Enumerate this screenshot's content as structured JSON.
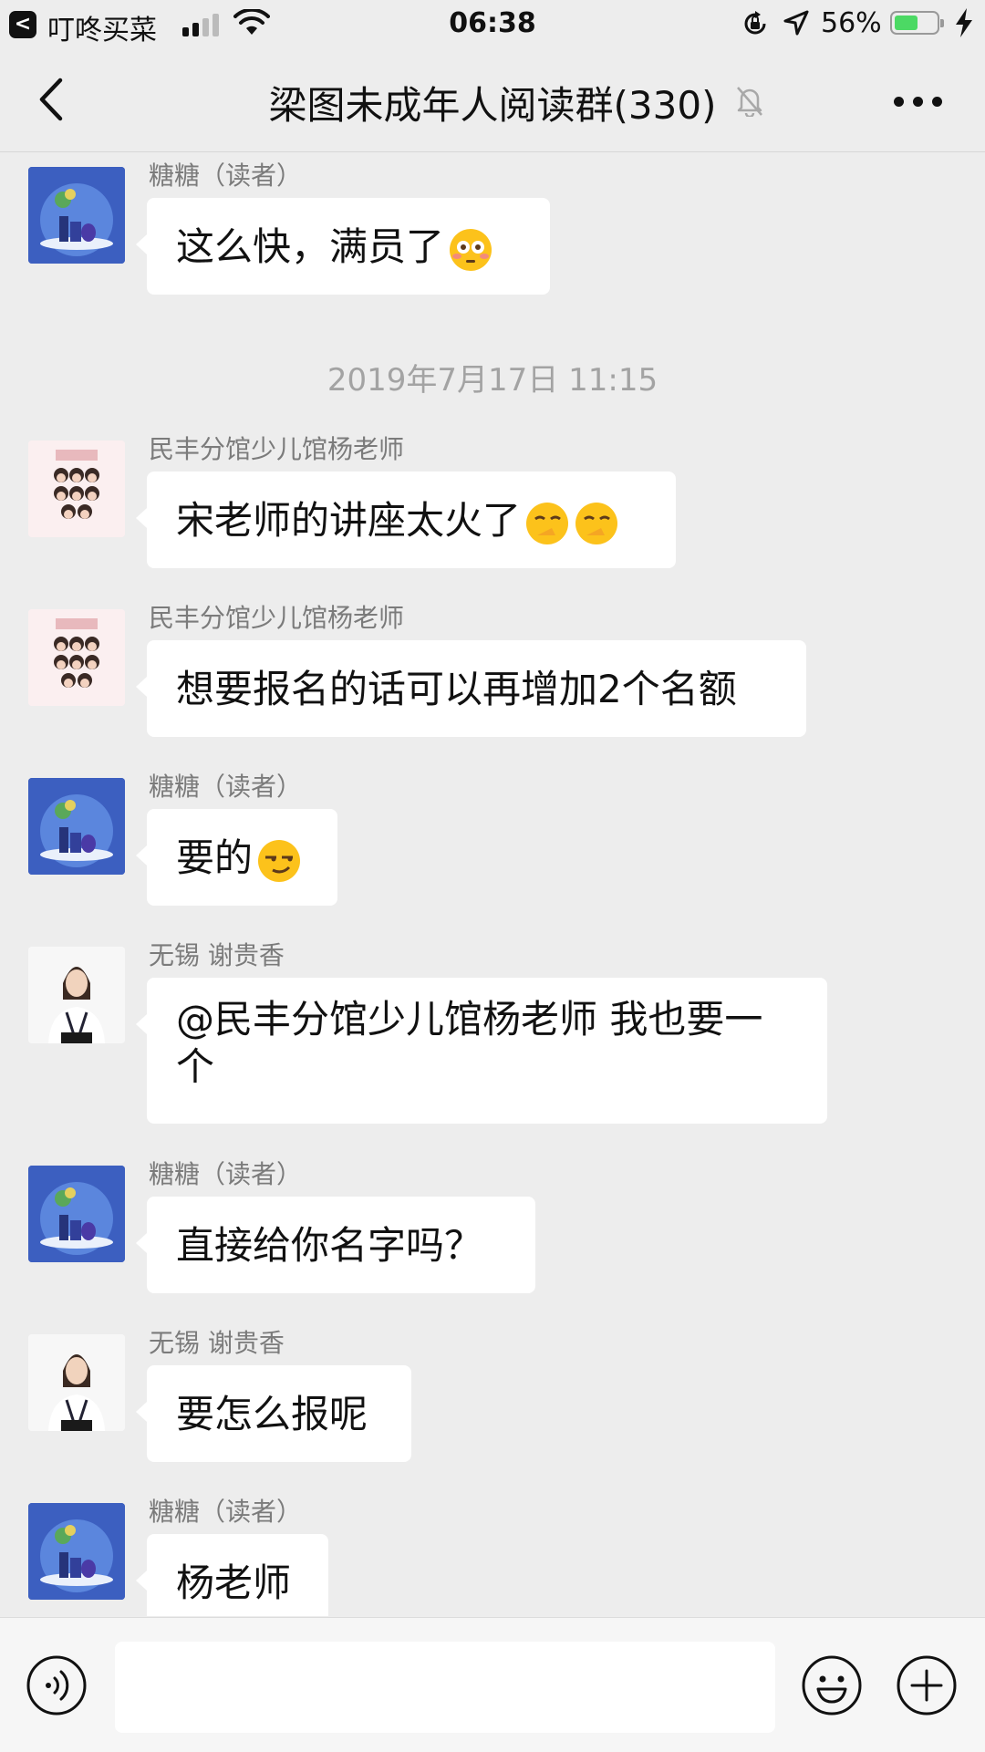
{
  "status_bar": {
    "back_app_glyph": "<",
    "app_name": "叮咚买菜",
    "time": "06:38",
    "battery_percent": "56%",
    "battery_level": 0.56,
    "icons": [
      "signal-icon",
      "wifi-icon",
      "rotation-lock-icon",
      "location-arrow-icon",
      "battery-icon",
      "charging-bolt-icon"
    ]
  },
  "header": {
    "title": "梁图未成年人阅读群(330)",
    "icons": [
      "back-chevron-icon",
      "mute-bell-icon",
      "more-dots-icon"
    ]
  },
  "messages": [
    {
      "sender": "糖糖（读者）",
      "text": "这么快，满员了",
      "avatar": "blue-vase",
      "emoji": "flushed-face"
    },
    {
      "type": "timestamp",
      "text": "2019年7月17日 11:15"
    },
    {
      "sender": "民丰分馆少儿馆杨老师",
      "text": "宋老师的讲座太火了",
      "avatar": "photo-grid",
      "emoji": "thinking-hand-face x2"
    },
    {
      "sender": "民丰分馆少儿馆杨老师",
      "text": "想要报名的话可以再增加2个名额",
      "avatar": "photo-grid"
    },
    {
      "sender": "糖糖（读者）",
      "text": "要的",
      "avatar": "blue-vase",
      "emoji": "smirk-face"
    },
    {
      "sender": "无锡  谢贵香",
      "text_line1": "@民丰分馆少儿馆杨老师 我也要一",
      "text_line2": "个",
      "avatar": "portrait"
    },
    {
      "sender": "糖糖（读者）",
      "text": "直接给你名字吗？",
      "avatar": "blue-vase"
    },
    {
      "sender": "无锡  谢贵香",
      "text": "要怎么报呢",
      "avatar": "portrait"
    },
    {
      "sender": "糖糖（读者）",
      "text": "杨老师",
      "avatar": "blue-vase"
    }
  ],
  "input_bar": {
    "placeholder": "",
    "icons": [
      "voice-icon",
      "emoji-icon",
      "plus-icon"
    ]
  },
  "colors": {
    "background": "#ededed",
    "bubble": "#ffffff",
    "battery": "#4cd964",
    "meta_text": "#7b7b7b"
  }
}
